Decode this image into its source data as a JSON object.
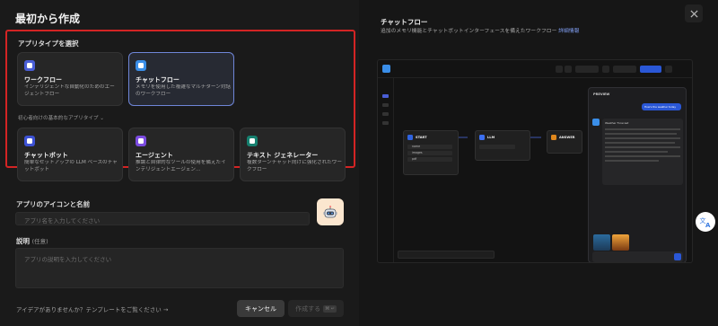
{
  "header": {
    "title": "最初から作成"
  },
  "app_type": {
    "label": "アプリタイプを選択",
    "beginner_label": "初心者向けの基本的なアプリタイプ ⌄",
    "cards": [
      {
        "title": "ワークフロー",
        "desc": "インテリジェントな自動化のためのエージェントフロー",
        "icon": "workflow-icon",
        "color": "#4a5ed6",
        "selected": false
      },
      {
        "title": "チャットフロー",
        "desc": "メモリを使用した複雑なマルチターン対話のワークフロー",
        "icon": "chatflow-icon",
        "color": "#3a8ee8",
        "selected": true
      },
      {
        "title": "チャットボット",
        "desc": "簡単なセットアップの LLM ベースのチャットボット",
        "icon": "chatbot-icon",
        "color": "#3d52d4",
        "selected": false
      },
      {
        "title": "エージェント",
        "desc": "推論と自律的なツールの使用を備えたインテリジェントエージェン…",
        "icon": "agent-icon",
        "color": "#7b4be0",
        "selected": false
      },
      {
        "title": "テキスト ジェネレーター",
        "desc": "複数ターンチャット向けに強化されたワークフロー",
        "icon": "text-generator-icon",
        "color": "#16806f",
        "selected": false
      }
    ]
  },
  "name_field": {
    "label": "アプリのアイコンと名前",
    "placeholder": "アプリ名を入力してください"
  },
  "desc_field": {
    "label": "説明",
    "optional": "(任意)",
    "placeholder": "アプリの説明を入力してください"
  },
  "footer": {
    "template_link": "アイデアがありませんか？テンプレートをご覧ください →",
    "cancel": "キャンセル",
    "create": "作成する",
    "create_kbd": "⌘ ↵"
  },
  "preview": {
    "title": "チャットフロー",
    "desc": "追加のメモリ機能とチャットボットインターフェースを備えたワークフロー",
    "link": "詳細情報",
    "screenshot": {
      "nodes": [
        {
          "name": "START",
          "color": "#2f63e0"
        },
        {
          "name": "LLM",
          "color": "#3c6ff0"
        },
        {
          "name": "ANSWER",
          "color": "#e0871c"
        }
      ],
      "start_vars": [
        "name",
        "images",
        "pdf"
      ],
      "panel_title": "PREVIEW",
      "user_msg": "How's the weather today",
      "bot_name": "Weather Forecast"
    }
  },
  "accent_color": "#d32424"
}
